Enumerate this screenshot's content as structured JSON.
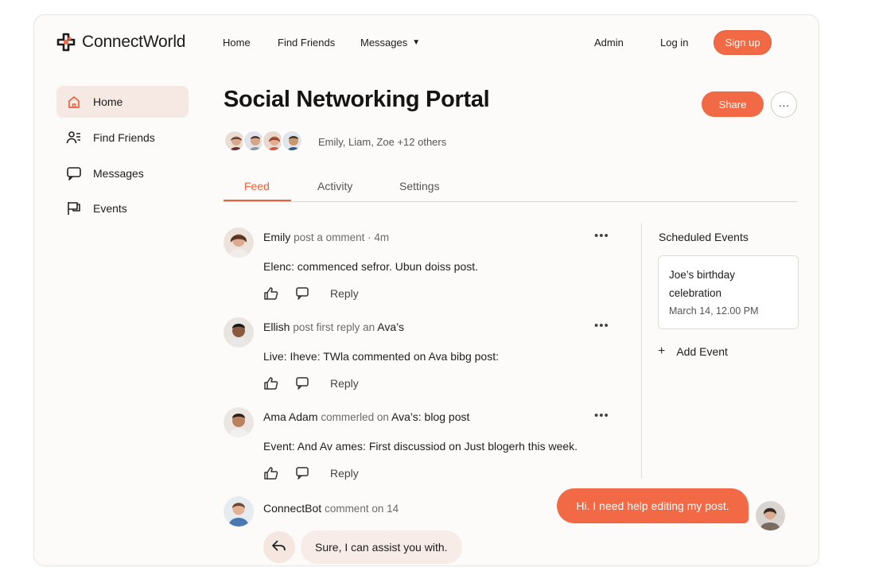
{
  "brand": {
    "name": "ConnectWorld",
    "accent": "#f26a45"
  },
  "topnav": {
    "home": "Home",
    "find_friends": "Find Friends",
    "messages": "Messages",
    "admin": "Admin",
    "login": "Log in",
    "signup": "Sign up"
  },
  "sidebar": {
    "items": [
      {
        "label": "Home",
        "icon": "home-icon",
        "active": true
      },
      {
        "label": "Find Friends",
        "icon": "friends-icon",
        "active": false
      },
      {
        "label": "Messages",
        "icon": "message-icon",
        "active": false
      },
      {
        "label": "Events",
        "icon": "flag-icon",
        "active": false
      }
    ]
  },
  "page": {
    "title": "Social Networking Portal",
    "share": "Share",
    "more": "···",
    "members_text": "Emily, Liam, Zoe +12 others"
  },
  "tabs": [
    "Feed",
    "Activity",
    "Settings"
  ],
  "feed": [
    {
      "author": "Emily",
      "meta": "post a omment · 4m",
      "body": "Elenc: commenced sefror. Ubun doiss post.",
      "reply": "Reply"
    },
    {
      "author": "Ellish",
      "meta": "post first reply an",
      "meta_tail": "Ava’s",
      "body": "Live: Iheve: TWla commented on Ava bibg post:",
      "reply": "Reply"
    },
    {
      "author": "Ama Adam",
      "meta": "commerled on",
      "meta_tail": "Ava’s: blog post",
      "body": "Event: And Av ames: First discussiod on Just blogerh this week.",
      "reply": "Reply"
    }
  ],
  "events": {
    "title": "Scheduled Events",
    "items": [
      {
        "name": "Joe’s birthday celebration",
        "date": "March 14, 12.00 PM"
      }
    ],
    "add_label": "Add Event"
  },
  "chat": {
    "bot_name": "ConnectBot",
    "bot_meta": "comment on 14",
    "bot_reply": "Sure, I can assist you with.",
    "user_message": "Hi. I need help editing my post."
  }
}
